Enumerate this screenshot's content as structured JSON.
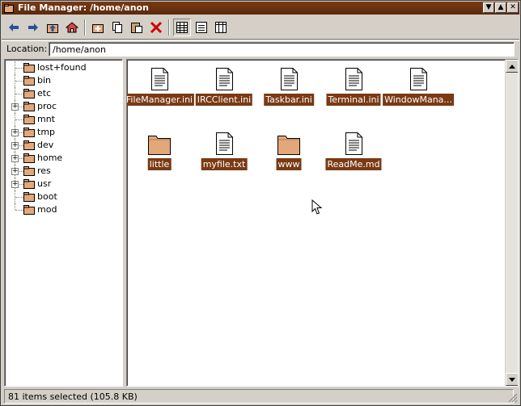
{
  "window": {
    "title": "File Manager: /home/anon"
  },
  "titlebar_buttons": [
    "▼",
    "▲",
    "✕"
  ],
  "toolbar": {
    "buttons": [
      "back-icon",
      "forward-icon",
      "up-icon",
      "home-icon",
      "new-folder-icon",
      "copy-icon",
      "paste-icon",
      "delete-icon",
      "icon-view-icon",
      "list-view-icon",
      "columns-view-icon"
    ]
  },
  "location": {
    "label": "Location:",
    "value": "/home/anon"
  },
  "tree": {
    "items": [
      {
        "label": "lost+found",
        "expandable": false
      },
      {
        "label": "bin",
        "expandable": false
      },
      {
        "label": "etc",
        "expandable": false
      },
      {
        "label": "proc",
        "expandable": true
      },
      {
        "label": "mnt",
        "expandable": false
      },
      {
        "label": "tmp",
        "expandable": true
      },
      {
        "label": "dev",
        "expandable": true
      },
      {
        "label": "home",
        "expandable": true
      },
      {
        "label": "res",
        "expandable": true
      },
      {
        "label": "usr",
        "expandable": true
      },
      {
        "label": "boot",
        "expandable": false
      },
      {
        "label": "mod",
        "expandable": false
      }
    ]
  },
  "files": [
    {
      "name": "FileManager.ini",
      "kind": "file"
    },
    {
      "name": "IRCClient.ini",
      "kind": "file"
    },
    {
      "name": "Taskbar.ini",
      "kind": "file"
    },
    {
      "name": "Terminal.ini",
      "kind": "file"
    },
    {
      "name": "WindowMana...",
      "kind": "file"
    },
    {
      "name": "little",
      "kind": "folder"
    },
    {
      "name": "myfile.txt",
      "kind": "file"
    },
    {
      "name": "www",
      "kind": "folder"
    },
    {
      "name": "ReadMe.md",
      "kind": "file"
    }
  ],
  "status": {
    "text": "81 items selected (105.8 KB)"
  },
  "colors": {
    "selection": "#7a3a14",
    "title_bar": "#7a3a14",
    "folder": "#e3a87a"
  }
}
